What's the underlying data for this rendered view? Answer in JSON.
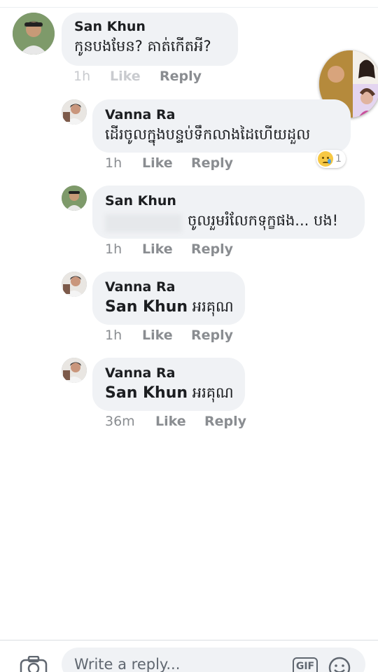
{
  "comments": [
    {
      "author": "San Khun",
      "text": "កូនបងមែន? គាត់កើតអី?",
      "time": "1h",
      "like_label": "Like",
      "reply_label": "Reply"
    },
    {
      "author": "Vanna Ra",
      "text": "ដើរចូលក្នុងបន្ទប់ទឹកលាងដៃហើយដួល",
      "time": "1h",
      "like_label": "Like",
      "reply_label": "Reply",
      "reaction_count": "1",
      "reaction_icon": "sad-emoji-icon"
    },
    {
      "author": "San Khun",
      "text": "ចូលរួមរំលែកទុក្ខផង... បង!",
      "time": "1h",
      "like_label": "Like",
      "reply_label": "Reply"
    },
    {
      "author": "Vanna Ra",
      "mention": "San Khun",
      "text": "អរគុណ",
      "time": "1h",
      "like_label": "Like",
      "reply_label": "Reply"
    },
    {
      "author": "Vanna Ra",
      "mention": "San Khun",
      "text": "អរគុណ",
      "time": "36m",
      "like_label": "Like",
      "reply_label": "Reply"
    }
  ],
  "composer": {
    "placeholder": "Write a reply...",
    "gif_label": "GIF",
    "camera_icon": "camera-icon",
    "emoji_icon": "emoji-icon"
  },
  "chat_head": {
    "icon": "chat-head-avatar"
  },
  "colors": {
    "bubble": "#f0f2f5",
    "meta_text": "#8a8d91",
    "body_text": "#1c1e21"
  }
}
